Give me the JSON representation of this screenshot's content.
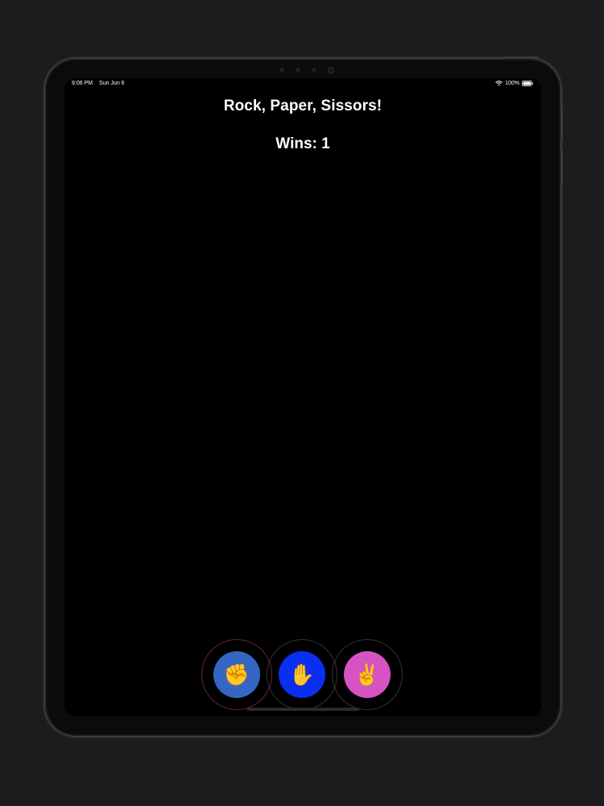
{
  "status_bar": {
    "time": "9:06 PM",
    "date": "Sun Jun 6",
    "battery": "100%"
  },
  "game": {
    "title": "Rock, Paper, Sissors!",
    "score_label": "Wins: 1",
    "choices": [
      {
        "name": "rock",
        "emoji": "✊",
        "icon": "raised-fist-icon",
        "color": "#3467c3"
      },
      {
        "name": "paper",
        "emoji": "✋",
        "icon": "raised-hand-icon",
        "color": "#0a2ff0"
      },
      {
        "name": "scissors",
        "emoji": "✌️",
        "icon": "victory-hand-icon",
        "color": "#d653c4"
      }
    ]
  },
  "colors": {
    "background": "#000000",
    "bezel": "#0b0b0c",
    "text": "#ffffff"
  }
}
